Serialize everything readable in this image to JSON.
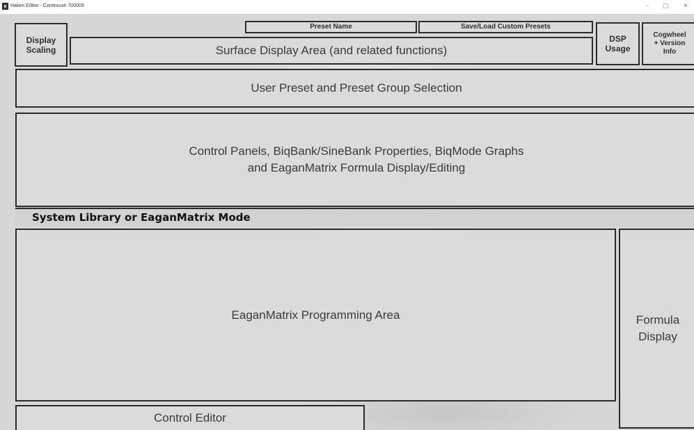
{
  "window": {
    "title": "Haken Editor - Continuum 700009",
    "minimize_glyph": "–",
    "maximize_glyph": "□",
    "close_glyph": "✕"
  },
  "header": {
    "display_scaling": "Display\nScaling",
    "preset_name": "Preset Name",
    "save_load": "Save/Load Custom Presets",
    "surface_display": "Surface Display Area (and related functions)",
    "dsp_usage": "DSP\nUsage",
    "cogwheel_info": "Cogwheel\n+ Version\nInfo"
  },
  "main": {
    "preset_selection": "User Preset and Preset Group Selection",
    "control_panels": "Control Panels, BiqBank/SineBank Properties, BiqMode Graphs\nand EaganMatrix Formula Display/Editing",
    "mode_label": "System Library or EaganMatrix Mode",
    "programming_area": "EaganMatrix Programming Area",
    "formula_display": "Formula\nDisplay",
    "control_editor": "Control Editor"
  },
  "icons": {
    "app": "haken-editor-app-icon"
  }
}
